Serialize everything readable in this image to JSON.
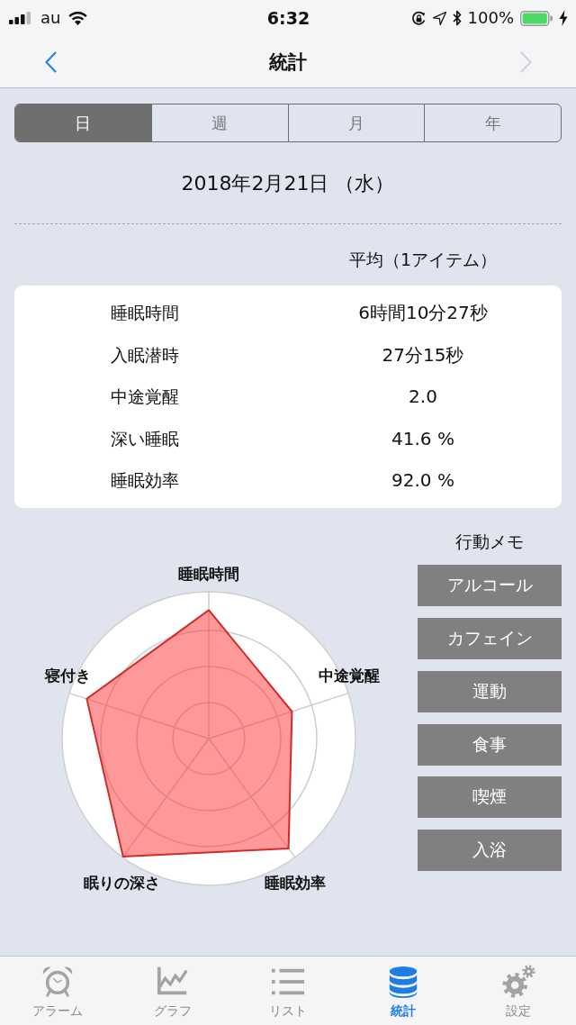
{
  "status_bar": {
    "carrier": "au",
    "time": "6:32",
    "battery": "100%"
  },
  "nav": {
    "title": "統計",
    "back": {
      "disabled": false
    },
    "forward": {
      "disabled": true
    }
  },
  "period_tabs": [
    {
      "label": "日",
      "selected": true
    },
    {
      "label": "週",
      "selected": false
    },
    {
      "label": "月",
      "selected": false
    },
    {
      "label": "年",
      "selected": false
    }
  ],
  "date": "2018年2月21日 （水）",
  "stats": {
    "column_header": "平均（1アイテム）",
    "rows": [
      {
        "label": "睡眠時間",
        "value": "6時間10分27秒"
      },
      {
        "label": "入眠潜時",
        "value": "27分15秒"
      },
      {
        "label": "中途覚醒",
        "value": "2.0"
      },
      {
        "label": "深い睡眠",
        "value": "41.6 %"
      },
      {
        "label": "睡眠効率",
        "value": "92.0 %"
      }
    ]
  },
  "radar": {
    "axes": [
      "睡眠時間",
      "中途覚醒",
      "睡眠効率",
      "眠りの深さ",
      "寝付き"
    ]
  },
  "behavior_memo": {
    "title": "行動メモ",
    "buttons": [
      "アルコール",
      "カフェイン",
      "運動",
      "食事",
      "喫煙",
      "入浴"
    ]
  },
  "tab_bar": [
    {
      "label": "アラーム",
      "selected": false
    },
    {
      "label": "グラフ",
      "selected": false
    },
    {
      "label": "リスト",
      "selected": false
    },
    {
      "label": "統計",
      "selected": true
    },
    {
      "label": "設定",
      "selected": false
    }
  ]
}
